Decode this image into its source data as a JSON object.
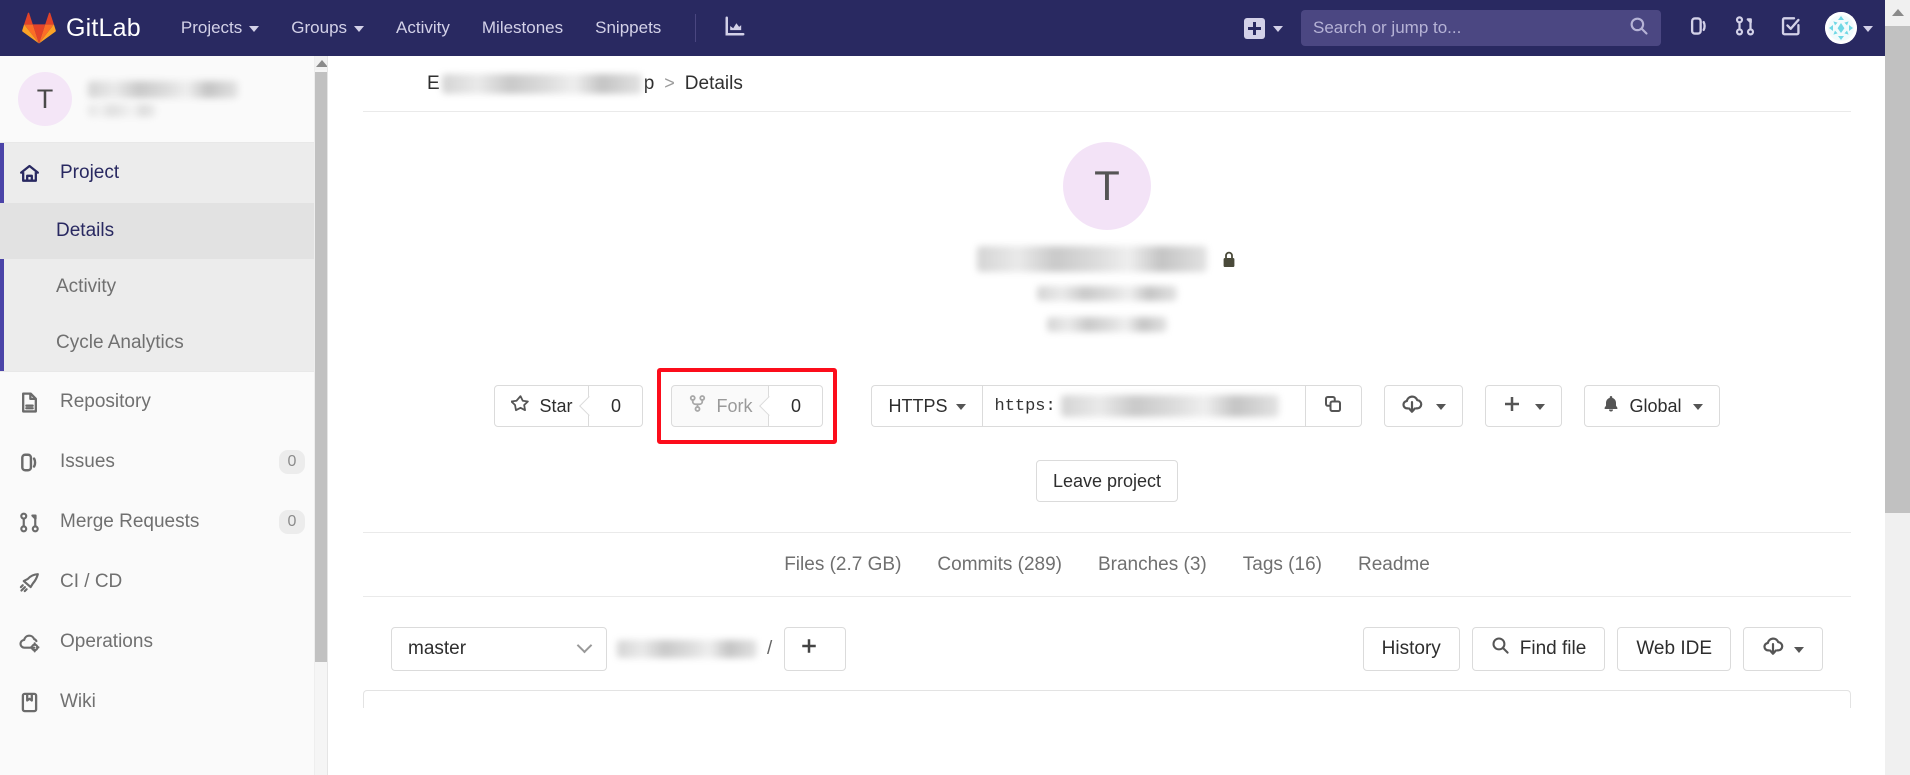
{
  "navbar": {
    "brand": "GitLab",
    "logo_icon": "gitlab-tanuki-logo",
    "links": [
      {
        "label": "Projects",
        "has_caret": true
      },
      {
        "label": "Groups",
        "has_caret": true
      },
      {
        "label": "Activity",
        "has_caret": false
      },
      {
        "label": "Milestones",
        "has_caret": false
      },
      {
        "label": "Snippets",
        "has_caret": false
      }
    ],
    "analytics_icon": "chart-bar-icon",
    "new_icon": "plus-square-icon",
    "search": {
      "value": "",
      "placeholder": "Search or jump to..."
    },
    "search_icon": "search-icon",
    "right_icons": [
      {
        "name": "issues-icon"
      },
      {
        "name": "merge-requests-icon"
      },
      {
        "name": "todos-done-icon"
      }
    ],
    "avatar_icon": "user-avatar",
    "avatar_caret": "chevron-down-icon"
  },
  "sidebar": {
    "project_initial": "T",
    "project_name_redacted": true,
    "items": [
      {
        "label": "Project",
        "icon": "home-icon",
        "active": true,
        "badge": ""
      },
      {
        "label": "Repository",
        "icon": "document-icon",
        "active": false,
        "badge": ""
      },
      {
        "label": "Issues",
        "icon": "issues-icon",
        "active": false,
        "badge": "0"
      },
      {
        "label": "Merge Requests",
        "icon": "merge-requests-icon",
        "active": false,
        "badge": "0"
      },
      {
        "label": "CI / CD",
        "icon": "rocket-icon",
        "active": false,
        "badge": ""
      },
      {
        "label": "Operations",
        "icon": "cloud-gear-icon",
        "active": false,
        "badge": ""
      },
      {
        "label": "Wiki",
        "icon": "book-icon",
        "active": false,
        "badge": ""
      }
    ],
    "sub_items": [
      {
        "label": "Details",
        "active": true
      },
      {
        "label": "Activity",
        "active": false
      },
      {
        "label": "Cycle Analytics",
        "active": false
      }
    ]
  },
  "breadcrumb": {
    "group_redacted": true,
    "separator": ">",
    "current": "Details"
  },
  "project": {
    "avatar_initial": "T",
    "title_redacted": true,
    "visibility_icon": "lock-icon",
    "subtitle_redacted": true,
    "description_redacted": true
  },
  "actions": {
    "star": {
      "label": "Star",
      "icon": "star-icon",
      "count": "0"
    },
    "fork": {
      "label": "Fork",
      "icon": "fork-icon",
      "count": "0",
      "highlighted": true,
      "highlight_color": "#fc0d1b"
    },
    "clone": {
      "protocol": "HTTPS",
      "protocol_caret": "caret-down-icon",
      "url_prefix": "https:",
      "url_redacted": true,
      "copy_icon": "copy-icon"
    },
    "download": {
      "icon": "download-cloud-icon",
      "caret": "caret-down-icon"
    },
    "add": {
      "icon": "plus-icon",
      "caret": "caret-down-icon"
    },
    "notifications": {
      "icon": "bell-icon",
      "label": "Global",
      "caret": "caret-down-icon"
    },
    "leave_project": "Leave project"
  },
  "stats": [
    {
      "label": "Files (2.7 GB)"
    },
    {
      "label": "Commits (289)"
    },
    {
      "label": "Branches (3)"
    },
    {
      "label": "Tags (16)"
    },
    {
      "label": "Readme"
    }
  ],
  "repo_toolbar": {
    "branch": "master",
    "branch_caret": "chevron-down-icon",
    "path_redacted": true,
    "path_slash": "/",
    "add_icon": "plus-icon",
    "add_caret": "chevron-down-icon",
    "buttons": [
      {
        "label": "History",
        "icon": ""
      },
      {
        "label": "Find file",
        "icon": "search-icon"
      },
      {
        "label": "Web IDE",
        "icon": ""
      }
    ],
    "download": {
      "icon": "download-cloud-icon",
      "caret": "caret-down-icon"
    }
  },
  "colors": {
    "navbar_bg": "#292961",
    "search_bg": "#4b4782",
    "sidebar_bg": "#fafafa",
    "sidebar_active": "#ececec",
    "accent_indigo": "#4b44a8",
    "avatar_lavender": "#f3e3f7",
    "highlight_red": "#fc0d1b",
    "scrollbar_thumb": "#c1c1c1"
  }
}
